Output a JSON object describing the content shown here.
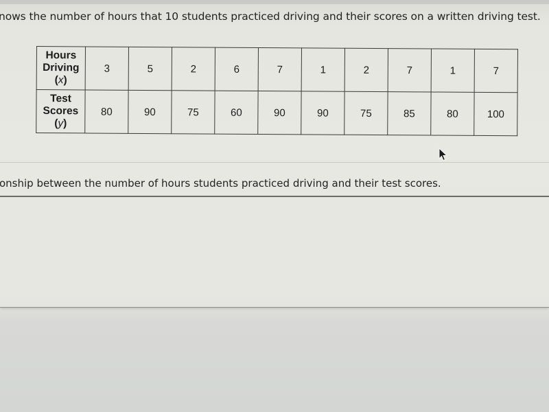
{
  "intro": {
    "text": "nows the number of hours that 10 students practiced driving and their scores on a written driving test."
  },
  "table": {
    "rows": [
      {
        "header_lines": [
          "Hours",
          "Driving"
        ],
        "variable": "x",
        "values": [
          "3",
          "5",
          "2",
          "6",
          "7",
          "1",
          "2",
          "7",
          "1",
          "7"
        ]
      },
      {
        "header_lines": [
          "Test",
          "Scores"
        ],
        "variable": "y",
        "values": [
          "80",
          "90",
          "75",
          "60",
          "90",
          "90",
          "75",
          "85",
          "80",
          "100"
        ]
      }
    ]
  },
  "question": {
    "text": "onship between the number of hours students practiced driving and their test scores."
  },
  "answer": {
    "value": ""
  },
  "cursor": {
    "icon": "arrow-pointer-icon"
  }
}
